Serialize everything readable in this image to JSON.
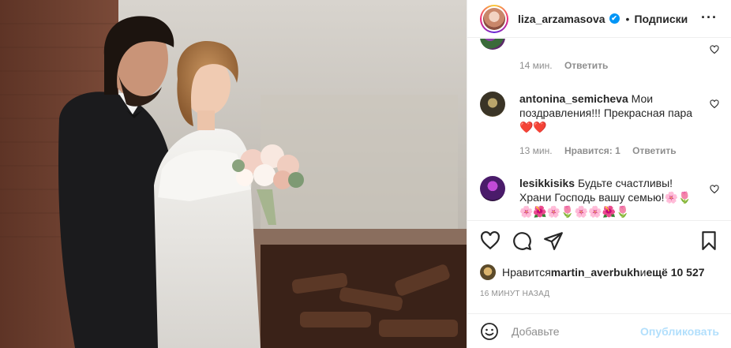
{
  "post": {
    "author": "liza_arzamasova",
    "verified_mark": "✔",
    "separator": "•",
    "follow_label": "Подписки",
    "more_label": "···"
  },
  "comments": [
    {
      "user": "",
      "text": "",
      "time": "14 мин.",
      "likes": "",
      "reply": "Ответить"
    },
    {
      "user": "antonina_semicheva",
      "text": " Мои поздравления!!! Прекрасная пара❤️❤️",
      "time": "13 мин.",
      "likes": "Нравится: 1",
      "reply": "Ответить"
    },
    {
      "user": "lesikkisiks",
      "text": " Будьте счастливы! Храни Господь вашу семью!🌸🌷🌸🌺🌸🌷🌸🌸🌺🌷",
      "time": "",
      "likes": "",
      "reply": ""
    }
  ],
  "likes": {
    "prefix": "Нравится ",
    "user": "martin_averbukh",
    "connector": " и ",
    "rest": "ещё 10 527"
  },
  "timestamp": "16 МИНУТ НАЗАД",
  "add_comment": {
    "placeholder": "Добавьте",
    "publish_label": "Опубликовать"
  },
  "icons": {
    "like": "heart-icon",
    "comment": "comment-icon",
    "share": "share-icon",
    "save": "bookmark-icon",
    "emoji": "smile-icon"
  },
  "colors": {
    "accent": "#0095f6",
    "publish_disabled": "#b2dffc",
    "meta": "#8e8e8e",
    "heart_emoji": "#ed4956"
  }
}
